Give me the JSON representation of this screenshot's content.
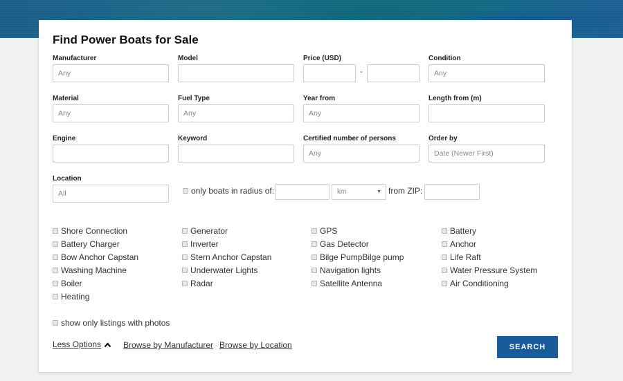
{
  "page": {
    "title": "Find Power Boats for Sale"
  },
  "fields": {
    "manufacturer": {
      "label": "Manufacturer",
      "value": "Any"
    },
    "model": {
      "label": "Model",
      "value": ""
    },
    "price": {
      "label": "Price (USD)",
      "min": "",
      "max": "",
      "separator": "-"
    },
    "condition": {
      "label": "Condition",
      "value": "Any"
    },
    "material": {
      "label": "Material",
      "value": "Any"
    },
    "fuel_type": {
      "label": "Fuel Type",
      "value": "Any"
    },
    "year_from": {
      "label": "Year from",
      "value": "Any"
    },
    "length_from": {
      "label": "Length from (m)",
      "value": ""
    },
    "engine": {
      "label": "Engine",
      "value": ""
    },
    "keyword": {
      "label": "Keyword",
      "value": ""
    },
    "certified_persons": {
      "label": "Certified number of persons",
      "value": "Any"
    },
    "order_by": {
      "label": "Order by",
      "value": "Date (Newer First)"
    },
    "location": {
      "label": "Location",
      "value": "All"
    }
  },
  "radius": {
    "checkbox_label": "only boats in radius of:",
    "checked": false,
    "distance": "",
    "unit": "km",
    "from_zip_label": "from ZIP:",
    "zip": ""
  },
  "amenities": [
    {
      "label": "Shore Connection",
      "checked": false
    },
    {
      "label": "Generator",
      "checked": false
    },
    {
      "label": "GPS",
      "checked": false
    },
    {
      "label": "Battery",
      "checked": false
    },
    {
      "label": "Battery Charger",
      "checked": false
    },
    {
      "label": "Inverter",
      "checked": false
    },
    {
      "label": "Gas Detector",
      "checked": false
    },
    {
      "label": "Anchor",
      "checked": false
    },
    {
      "label": "Bow Anchor Capstan",
      "checked": false
    },
    {
      "label": "Stern Anchor Capstan",
      "checked": false
    },
    {
      "label": "Bilge PumpBilge pump",
      "checked": false
    },
    {
      "label": "Life Raft",
      "checked": false
    },
    {
      "label": "Washing Machine",
      "checked": false
    },
    {
      "label": "Underwater Lights",
      "checked": false
    },
    {
      "label": "Navigation lights",
      "checked": false
    },
    {
      "label": "Water Pressure System",
      "checked": false
    },
    {
      "label": "Boiler",
      "checked": false
    },
    {
      "label": "Radar",
      "checked": false
    },
    {
      "label": "Satellite Antenna",
      "checked": false
    },
    {
      "label": "Air Conditioning",
      "checked": false
    },
    {
      "label": "Heating",
      "checked": false
    }
  ],
  "photos_only": {
    "label": "show only listings with photos",
    "checked": false
  },
  "footer": {
    "less_options": "Less Options",
    "browse_manufacturer": "Browse by Manufacturer",
    "browse_location": "Browse by Location",
    "search_button": "SEARCH"
  },
  "colors": {
    "accent": "#1a5c9a",
    "background": "#f0f1f1"
  }
}
